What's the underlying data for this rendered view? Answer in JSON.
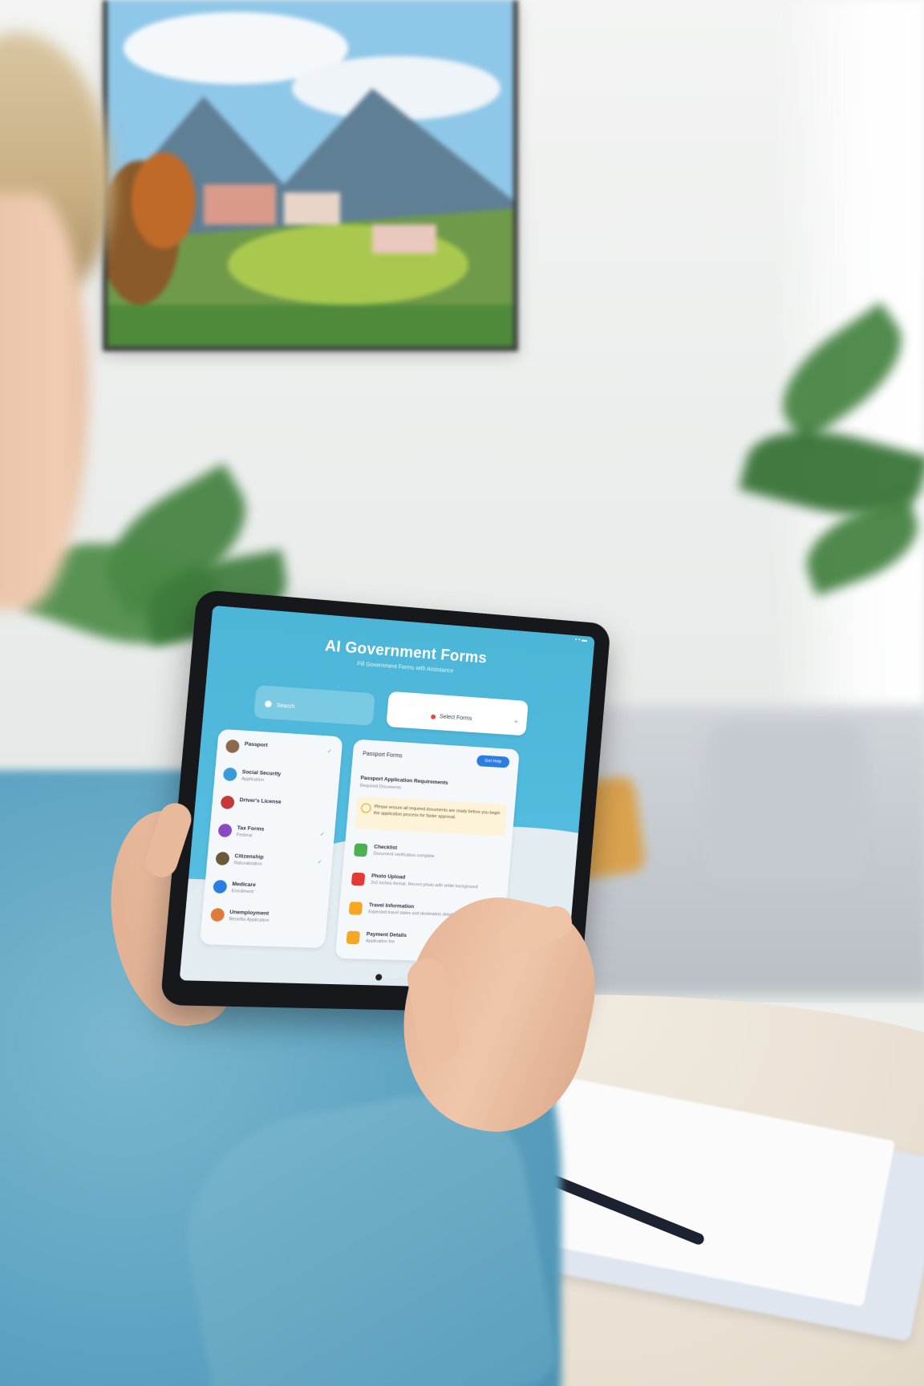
{
  "app": {
    "title": "AI Government Forms",
    "subtitle": "Fill Government Forms with Assistance"
  },
  "status_bar": {
    "time": "",
    "indicators": "▪ ▪ ▬"
  },
  "search": {
    "left_label": "Search",
    "right_label": "Select Forms"
  },
  "sidebar": {
    "items": [
      {
        "label": "Passport",
        "sub": "",
        "color": "#8a6a4a",
        "check": "✓"
      },
      {
        "label": "Social Security",
        "sub": "Application",
        "color": "#3a9ad9",
        "check": ""
      },
      {
        "label": "Driver's License",
        "sub": "",
        "color": "#c23a3a",
        "check": ""
      },
      {
        "label": "Tax Forms",
        "sub": "Federal",
        "color": "#8a4ac2",
        "check": "✓"
      },
      {
        "label": "Citizenship",
        "sub": "Naturalization",
        "color": "#6a5a3a",
        "check": "✓"
      },
      {
        "label": "Medicare",
        "sub": "Enrollment",
        "color": "#2a7de1",
        "check": ""
      },
      {
        "label": "Unemployment",
        "sub": "Benefits Application",
        "color": "#e07a3a",
        "check": ""
      }
    ]
  },
  "detail": {
    "header": "Passport Forms",
    "button": "Get Help",
    "section_title": "Passport Application Requirements",
    "section_sub": "Required Documents",
    "alert_text": "Please ensure all required documents are ready before you begin the application process for faster approval.",
    "items": [
      {
        "label": "Checklist",
        "sub": "Document verification complete",
        "color": "#4caf50"
      },
      {
        "label": "Photo Upload",
        "sub": "2x2 inches format. Recent photo with white background",
        "color": "#e53935"
      },
      {
        "label": "Travel Information",
        "sub": "Expected travel dates and destination details",
        "color": "#f5a623"
      },
      {
        "label": "Payment Details",
        "sub": "Application fee",
        "color": "#f5a623"
      }
    ]
  }
}
